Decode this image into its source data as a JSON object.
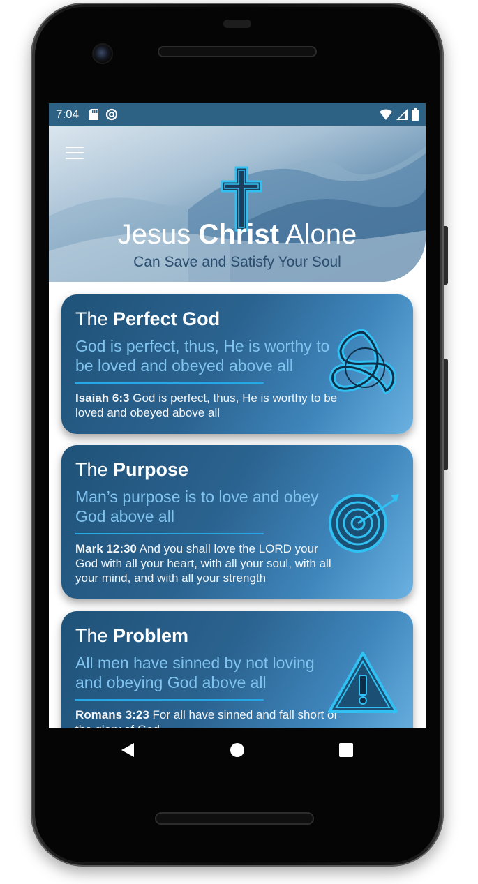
{
  "status_bar": {
    "time": "7:04"
  },
  "header": {
    "title_plain": "Jesus ",
    "title_bold": "Christ",
    "title_end": " Alone",
    "subtitle": "Can Save and Satisfy Your Soul"
  },
  "cards": [
    {
      "title_plain": "The ",
      "title_bold": "Perfect God",
      "summary": "God is perfect, thus, He is worthy to be loved and obeyed above all",
      "verse_ref": "Isaiah 6:3",
      "verse_text": " God is perfect, thus, He is worthy to be loved and obeyed above all",
      "icon": "trinity-knot-icon"
    },
    {
      "title_plain": "The ",
      "title_bold": "Purpose",
      "summary": "Man’s purpose is to love and obey God above all",
      "verse_ref": "Mark 12:30",
      "verse_text": " And you shall love the LORD your God with all your heart, with all your soul, with all your mind, and with all your strength",
      "icon": "target-arrow-icon"
    },
    {
      "title_plain": "The ",
      "title_bold": "Problem",
      "summary": "All men have sinned by not loving and obeying God above all",
      "verse_ref": "Romans 3:23",
      "verse_text": " For all have sinned and fall short of the glory of God",
      "icon": "warning-icon"
    }
  ],
  "colors": {
    "accent": "#27a8e6",
    "card_dark": "#1f5278",
    "summary_text": "#7fc3ee",
    "status_bar": "#2e6285"
  }
}
